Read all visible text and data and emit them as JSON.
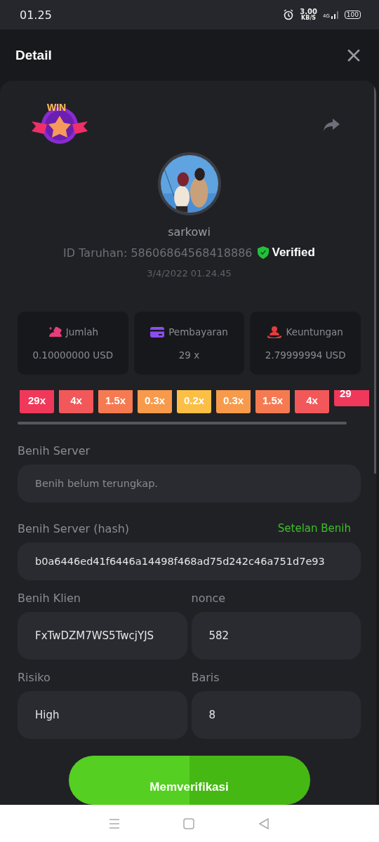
{
  "status_bar": {
    "time": "01.25",
    "speed_value": "3.00",
    "speed_unit": "KB/S",
    "network": "4G",
    "battery": "100"
  },
  "header": {
    "title": "Detail"
  },
  "bet": {
    "username": "sarkowi",
    "bet_id": "ID Taruhan: 58606864568418886",
    "verified": true,
    "verified_label": "Verified",
    "date": "3/4/2022 01.24.45",
    "win_label": "WIN"
  },
  "stats": [
    {
      "kind": "amount",
      "label": "Jumlah",
      "value": "0.10000000 USD"
    },
    {
      "kind": "payout",
      "label": "Pembayaran",
      "value": "29 x"
    },
    {
      "kind": "profit",
      "label": "Keuntungan",
      "value": "2.79999994 USD"
    }
  ],
  "multipliers": [
    {
      "label": "29x",
      "color": "#f0395a",
      "selected": false
    },
    {
      "label": "4x",
      "color": "#f2585a",
      "selected": false
    },
    {
      "label": "1.5x",
      "color": "#f57a52",
      "selected": false
    },
    {
      "label": "0.3x",
      "color": "#f79a4c",
      "selected": false
    },
    {
      "label": "0.2x",
      "color": "#fbbf45",
      "selected": false
    },
    {
      "label": "0.3x",
      "color": "#f79a4c",
      "selected": false
    },
    {
      "label": "1.5x",
      "color": "#f57a52",
      "selected": false
    },
    {
      "label": "4x",
      "color": "#f2585a",
      "selected": false
    },
    {
      "label": "29",
      "color": "#f0395a",
      "selected": true
    }
  ],
  "fields": [
    {
      "label": "Benih Server",
      "placeholder": "Benih belum terungkap."
    },
    {
      "label": "Benih Server (hash)",
      "link": "Setelan Benih",
      "value": "b0a6446ed41f6446a14498f468ad75d242c46a751d7e93"
    }
  ],
  "field_pairs": [
    [
      {
        "label": "Benih Klien",
        "value": "FxTwDZM7WS5TwcjYJS"
      },
      {
        "label": "nonce",
        "value": "582"
      }
    ],
    [
      {
        "label": "Risiko",
        "value": "High"
      },
      {
        "label": "Baris",
        "value": "8"
      }
    ]
  ],
  "verify_button": {
    "label": "Memverifikasi"
  }
}
